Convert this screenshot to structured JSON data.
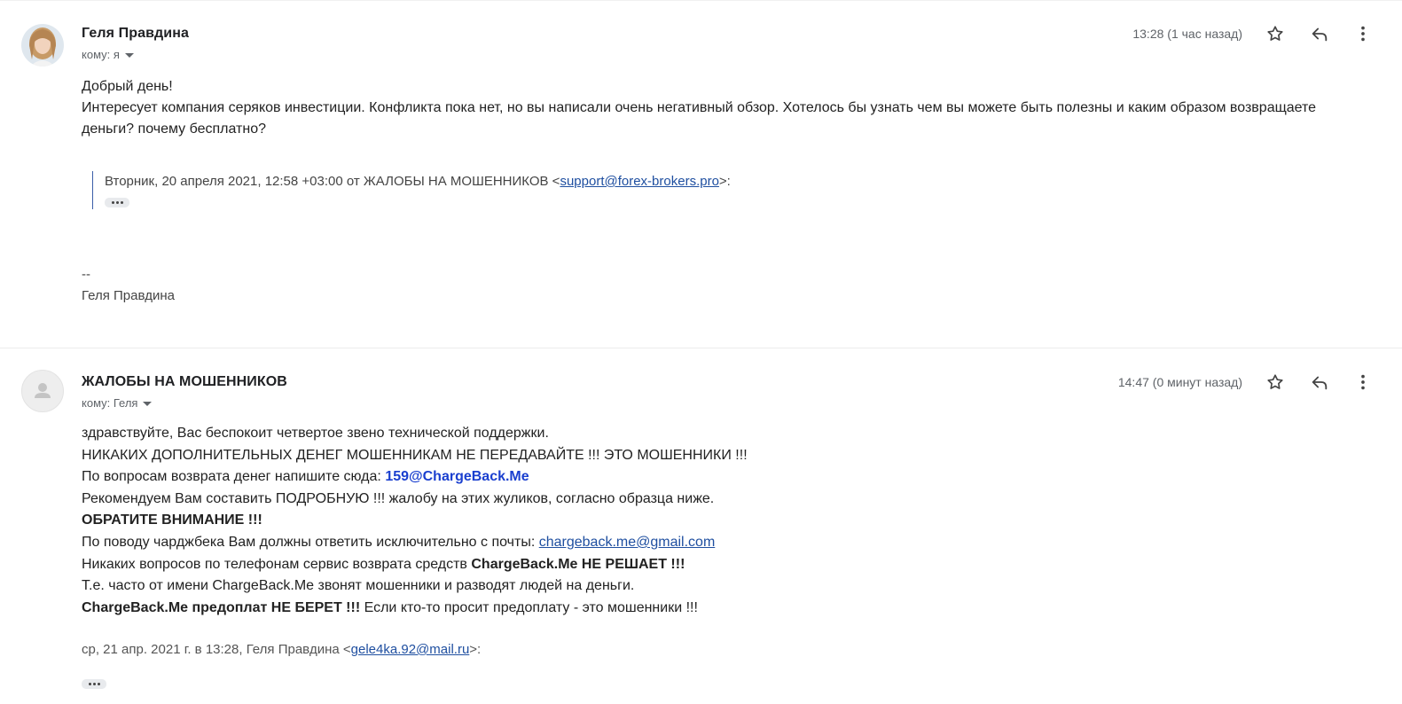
{
  "messages": [
    {
      "sender": "Геля Правдина",
      "recipient": "кому: я",
      "time": "13:28 (1 час назад)",
      "body": {
        "greeting": "Добрый день!",
        "paragraph": "Интересует компания серяков инвестиции. Конфликта пока нет, но вы написали очень негативный обзор. Хотелось бы узнать чем вы можете быть полезны и каким образом возвращаете деньги? почему бесплатно?"
      },
      "quote": {
        "prefix": "Вторник, 20 апреля 2021, 12:58 +03:00 от ЖАЛОБЫ НА МОШЕННИКОВ <",
        "email": "support@forex-brokers.pro",
        "suffix": ">:"
      },
      "signature": {
        "dashes": "--",
        "name": "Геля Правдина"
      }
    },
    {
      "sender": "ЖАЛОБЫ НА МОШЕННИКОВ",
      "recipient": "кому: Геля",
      "time": "14:47 (0 минут назад)",
      "body": {
        "line1": "здравствуйте, Вас беспокоит четвертое звено технической поддержки.",
        "line2": "НИКАКИХ ДОПОЛНИТЕЛЬНЫХ ДЕНЕГ МОШЕННИКАМ НЕ ПЕРЕДАВАЙТЕ !!! ЭТО МОШЕННИКИ !!!",
        "line3_prefix": "По вопросам возврата денег напишите сюда: ",
        "line3_email": "159@ChargeBack.Me",
        "line4": "Рекомендуем Вам составить ПОДРОБНУЮ !!! жалобу на этих жуликов, согласно образца ниже.",
        "line5": "ОБРАТИТЕ ВНИМАНИЕ !!!",
        "line6_prefix": "По поводу чарджбека Вам должны ответить исключительно с почты: ",
        "line6_email": "chargeback.me@gmail.com",
        "line7_prefix": "Никаких вопросов по телефонам сервис возврата средств ",
        "line7_bold": "ChargeBack.Me НЕ РЕШАЕТ !!!",
        "line8": "Т.е. часто от имени ChargeBack.Me звонят мошенники и разводят людей на деньги.",
        "line9_bold": "ChargeBack.Me предоплат НЕ БЕРЕТ !!!",
        "line9_suffix": " Если кто-то просит предоплату - это мошенники !!!"
      },
      "quote": {
        "prefix": "ср, 21 апр. 2021 г. в 13:28, Геля Правдина <",
        "email": "gele4ka.92@mail.ru",
        "suffix": ">:"
      }
    }
  ],
  "icons": {
    "star": "star-icon",
    "reply": "reply-icon",
    "more": "more-vertical-icon",
    "caret": "chevron-down-icon",
    "avatar_default": "person-icon"
  },
  "colors": {
    "link": "#1f4fa0",
    "highlight_email": "#1a3fcf",
    "quote_bar": "#3a5ea8",
    "meta_text": "#5f6368"
  }
}
